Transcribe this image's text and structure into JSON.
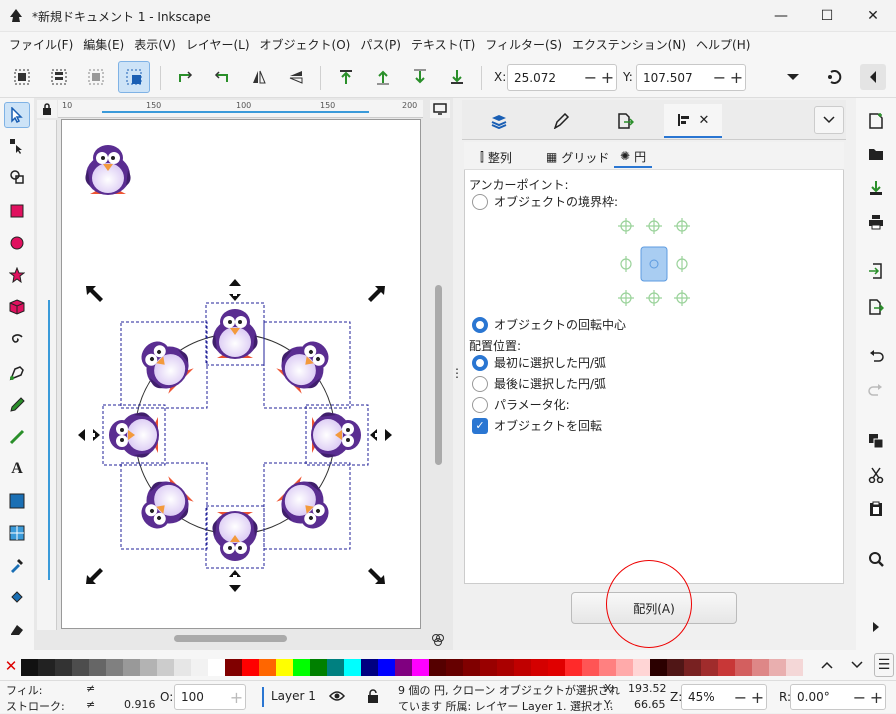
{
  "window": {
    "title": "*新規ドキュメント 1 - Inkscape",
    "minimize": "—",
    "maximize": "☐",
    "close": "✕"
  },
  "menu": [
    "ファイル(F)",
    "編集(E)",
    "表示(V)",
    "レイヤー(L)",
    "オブジェクト(O)",
    "パス(P)",
    "テキスト(T)",
    "フィルター(S)",
    "エクステンション(N)",
    "ヘルプ(H)"
  ],
  "toolbar": {
    "x_label": "X:",
    "x_value": "25.072",
    "y_label": "Y:",
    "y_value": "107.507",
    "minus": "−",
    "plus": "+"
  },
  "ruler": {
    "h_ticks": [
      "10",
      "150",
      "100",
      "150",
      "200"
    ]
  },
  "panel": {
    "subtabs": [
      "整列",
      "グリッド",
      "円"
    ],
    "anchor_label": "アンカーポイント:",
    "bbox_option": "オブジェクトの境界枠:",
    "rotation_center_option": "オブジェクトの回転中心",
    "placement_label": "配置位置:",
    "first_selected": "最初に選択した円/弧",
    "last_selected": "最後に選択した円/弧",
    "parametric": "パラメータ化:",
    "rotate_objects": "オブジェクトを回転",
    "arrange_button": "配列(A)"
  },
  "palette_colors": [
    "#111111",
    "#222222",
    "#333333",
    "#4d4d4d",
    "#666666",
    "#808080",
    "#999999",
    "#b3b3b3",
    "#cccccc",
    "#e6e6e6",
    "#f2f2f2",
    "#ffffff",
    "#800000",
    "#ff0000",
    "#ff6600",
    "#ffff00",
    "#00ff00",
    "#008000",
    "#008080",
    "#00ffff",
    "#000080",
    "#0000ff",
    "#800080",
    "#ff00ff",
    "#550000",
    "#660000",
    "#800000",
    "#990000",
    "#aa0000",
    "#c00000",
    "#d40000",
    "#e00000",
    "#ff2a2a",
    "#ff5555",
    "#ff8080",
    "#ffaaaa",
    "#ffd5d5",
    "#2b0000",
    "#501616",
    "#782121",
    "#a02c2c",
    "#c83737",
    "#d35f5f",
    "#de8787",
    "#e9afaf",
    "#f4d7d7"
  ],
  "status": {
    "fill_label": "フィル:",
    "fill_value": "≠",
    "stroke_label": "ストローク:",
    "stroke_value": "≠",
    "stroke_width": "0.916",
    "opacity_label": "O:",
    "opacity_value": "100",
    "layer": "Layer 1",
    "message_line1": "9 個の 円, クローン オブジェクトが選択され",
    "message_line2": "ています 所属: レイヤー Layer 1. 選択オ...",
    "x_label": "X:",
    "x_value": "193.52",
    "y_label": "Y:",
    "y_value": "66.65",
    "zoom_label": "Z:",
    "zoom_value": "45%",
    "rotation_label": "R:",
    "rotation_value": "0.00°"
  }
}
